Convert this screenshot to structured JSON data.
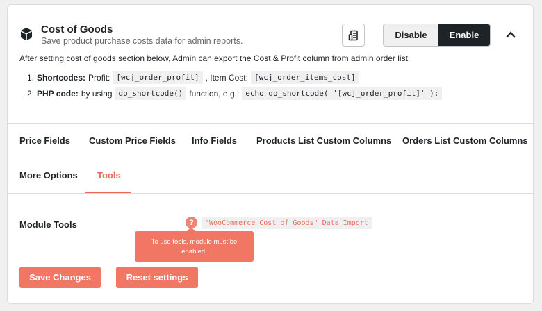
{
  "module": {
    "title": "Cost of Goods",
    "subtitle": "Save product purchase costs data for admin reports.",
    "icon": "cube-icon",
    "disable_label": "Disable",
    "enable_label": "Enable",
    "enabled_state": "Enable"
  },
  "description": "After setting cost of goods section below, Admin can export the Cost & Profit column from admin order list:",
  "list": [
    {
      "number": "1.",
      "bold": "Shortcodes:",
      "text1": "Profit:",
      "code1": "[wcj_order_profit]",
      "text2": ", Item Cost:",
      "code2": "[wcj_order_items_cost]"
    },
    {
      "number": "2.",
      "bold": "PHP code:",
      "text1": "by using",
      "code1": "do_shortcode()",
      "text2": "function, e.g.:",
      "code2": "echo do_shortcode( '[wcj_order_profit]' );"
    }
  ],
  "tabs": [
    {
      "label": "Price Fields"
    },
    {
      "label": "Custom Price Fields"
    },
    {
      "label": "Info Fields"
    },
    {
      "label": "Products List Custom Columns"
    },
    {
      "label": "Orders List Custom Columns"
    },
    {
      "label": "More Options"
    },
    {
      "label": "Tools"
    }
  ],
  "active_tab": "Tools",
  "tools": {
    "label": "Module Tools",
    "help_glyph": "?",
    "link": "\"WooCommerce Cost of Goods\" Data Import",
    "tooltip": "To use tools, module must be enabled."
  },
  "buttons": {
    "save": "Save Changes",
    "reset": "Reset settings"
  },
  "colors": {
    "accent": "#f27664",
    "dark": "#1d2327"
  }
}
